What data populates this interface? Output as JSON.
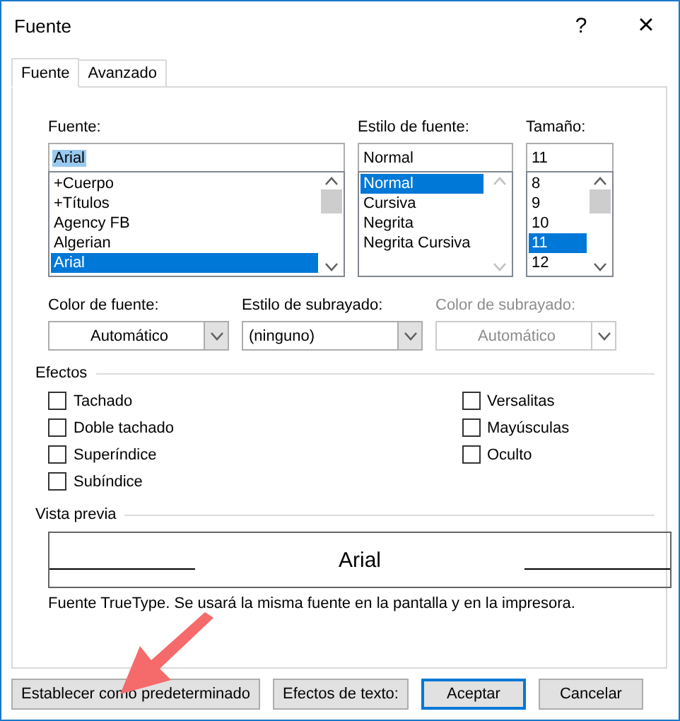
{
  "window": {
    "title": "Fuente",
    "help": "?",
    "close": "×"
  },
  "tabs": [
    {
      "label": "Fuente",
      "selected": true
    },
    {
      "label": "Avanzado",
      "selected": false
    }
  ],
  "pickers": [
    {
      "label": "Fuente:",
      "value": "Arial",
      "value_selected": true,
      "scrollable": true,
      "items": [
        {
          "label": "+Cuerpo",
          "selected": false
        },
        {
          "label": "+Títulos",
          "selected": false
        },
        {
          "label": "Agency FB",
          "selected": false
        },
        {
          "label": "Algerian",
          "selected": false
        },
        {
          "label": "Arial",
          "selected": true
        }
      ]
    },
    {
      "label": "Estilo de fuente:",
      "value": "Normal",
      "value_selected": false,
      "scrollable": false,
      "items": [
        {
          "label": "Normal",
          "selected": true
        },
        {
          "label": "Cursiva",
          "selected": false
        },
        {
          "label": "Negrita",
          "selected": false
        },
        {
          "label": "Negrita Cursiva",
          "selected": false
        }
      ]
    },
    {
      "label": "Tamaño:",
      "value": "11",
      "value_selected": false,
      "scrollable": true,
      "items": [
        {
          "label": "8",
          "selected": false
        },
        {
          "label": "9",
          "selected": false
        },
        {
          "label": "10",
          "selected": false
        },
        {
          "label": "11",
          "selected": true
        },
        {
          "label": "12",
          "selected": false
        }
      ]
    }
  ],
  "dropdowns": [
    {
      "label": "Color de fuente:",
      "value": "Automático",
      "kind": "color",
      "disabled": false
    },
    {
      "label": "Estilo de subrayado:",
      "value": "(ninguno)",
      "kind": "list",
      "disabled": false
    },
    {
      "label": "Color de subrayado:",
      "value": "Automático",
      "kind": "color",
      "disabled": true
    }
  ],
  "effects": {
    "title": "Efectos",
    "columns": [
      [
        {
          "label": "Tachado",
          "checked": false
        },
        {
          "label": "Doble tachado",
          "checked": false
        },
        {
          "label": "Superíndice",
          "checked": false
        },
        {
          "label": "Subíndice",
          "checked": false
        }
      ],
      [
        {
          "label": "Versalitas",
          "checked": false
        },
        {
          "label": "Mayúsculas",
          "checked": false
        },
        {
          "label": "Oculto",
          "checked": false
        }
      ]
    ]
  },
  "preview": {
    "title": "Vista previa",
    "sample": "Arial",
    "note": "Fuente TrueType. Se usará la misma fuente en la pantalla y en la impresora."
  },
  "buttons": [
    {
      "label": "Establecer como predeterminado",
      "default": false
    },
    {
      "label": "Efectos de texto:",
      "default": false
    },
    {
      "label": "Aceptar",
      "default": true
    },
    {
      "label": "Cancelar",
      "default": false
    }
  ]
}
